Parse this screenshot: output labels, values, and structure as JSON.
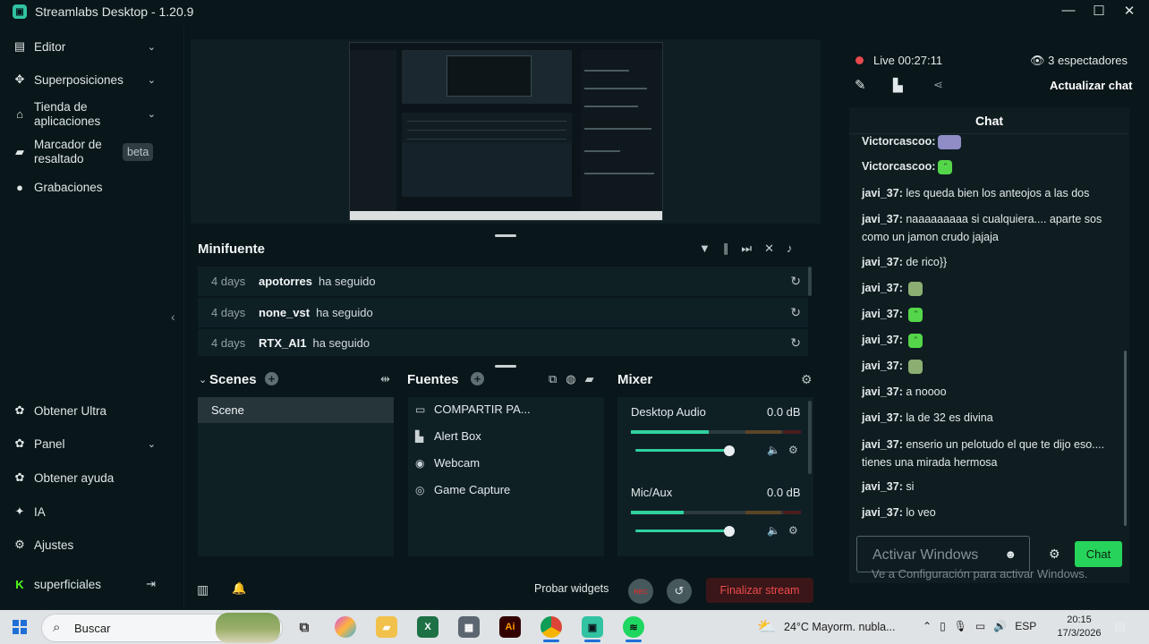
{
  "window": {
    "title": "Streamlabs Desktop - 1.20.9",
    "controls": [
      "—",
      "☐",
      "✕"
    ]
  },
  "sidebar": {
    "items": [
      {
        "label": "Editor",
        "icon": "editor-icon"
      },
      {
        "label": "Superposiciones",
        "icon": "themes-icon"
      },
      {
        "label1": "Tienda de",
        "label2": "aplicaciones",
        "icon": "store-icon"
      },
      {
        "label1": "Marcador de",
        "label2": "resaltado",
        "icon": "highlighter-icon",
        "badge": "beta"
      },
      {
        "label": "Grabaciones",
        "icon": "recordings-icon"
      }
    ],
    "bottom": [
      {
        "label": "Obtener Ultra",
        "icon": "ultra-icon"
      },
      {
        "label": "Panel",
        "icon": "dashboard-icon"
      },
      {
        "label": "Obtener ayuda",
        "icon": "help-icon"
      },
      {
        "label": "IA",
        "icon": "ai-icon"
      },
      {
        "label": "Ajustes",
        "icon": "settings-icon"
      },
      {
        "label": "superficiales",
        "icon": "kick-icon"
      }
    ]
  },
  "minifeed": {
    "title": "Minifuente",
    "events": [
      {
        "time": "4 days",
        "user": "apotorres",
        "action": "ha seguido"
      },
      {
        "time": "4 days",
        "user": "none_vst",
        "action": "ha seguido"
      },
      {
        "time": "4 days",
        "user": "RTX_AI1",
        "action": "ha seguido"
      }
    ]
  },
  "scenes": {
    "title": "Scenes",
    "items": [
      "Scene"
    ]
  },
  "sources": {
    "title": "Fuentes",
    "items": [
      {
        "label": "COMPARTIR PA...",
        "icon": "monitor-icon"
      },
      {
        "label": "Alert Box",
        "icon": "alert-box-icon"
      },
      {
        "label": "Webcam",
        "icon": "webcam-icon"
      },
      {
        "label": "Game Capture",
        "icon": "gamepad-icon"
      }
    ]
  },
  "mixer": {
    "title": "Mixer",
    "channels": [
      {
        "name": "Desktop Audio",
        "db": "0.0 dB",
        "level": 0.46,
        "volume": 0.82
      },
      {
        "name": "Mic/Aux",
        "db": "0.0 dB",
        "level": 0.31,
        "volume": 0.82
      }
    ]
  },
  "bottom_bar": {
    "test_widgets": "Probar widgets",
    "rec": "REC",
    "end_stream": "Finalizar stream"
  },
  "live": {
    "status": "Live",
    "time": "00:27:11",
    "viewers": "3 espectadores",
    "refresh": "Actualizar chat"
  },
  "chat": {
    "title": "Chat",
    "messages": [
      {
        "user": "Victorcascoo:",
        "text": "",
        "emote": "p"
      },
      {
        "user": "Victorcascoo:",
        "text": "",
        "emote": "g"
      },
      {
        "user": "javi_37:",
        "text": "les queda bien los anteojos a las dos"
      },
      {
        "user": "javi_37:",
        "text": "naaaaaaaaa si cualquiera.... aparte sos como un jamon crudo jajaja"
      },
      {
        "user": "javi_37:",
        "text": "de rico}}"
      },
      {
        "user": "javi_37:",
        "text": "",
        "emote": "m"
      },
      {
        "user": "javi_37:",
        "text": "",
        "emote": "g"
      },
      {
        "user": "javi_37:",
        "text": "",
        "emote": "g"
      },
      {
        "user": "javi_37:",
        "text": "",
        "emote": "m"
      },
      {
        "user": "javi_37:",
        "text": "a noooo"
      },
      {
        "user": "javi_37:",
        "text": "la de 32 es divina"
      },
      {
        "user": "javi_37:",
        "text": "enserio un pelotudo el que te dijo eso.... tienes una mirada hermosa"
      },
      {
        "user": "javi_37:",
        "text": "si"
      },
      {
        "user": "javi_37:",
        "text": "lo veo"
      }
    ],
    "input_placeholder": "",
    "send": "Chat"
  },
  "watermark": {
    "line1": "Activar Windows",
    "line2": "Ve a Configuración para activar Windows."
  },
  "taskbar": {
    "search": "Buscar",
    "weather": "24°C  Mayorm. nubla...",
    "lang": "ESP",
    "time": "20:15",
    "date": "17/3/2026"
  }
}
